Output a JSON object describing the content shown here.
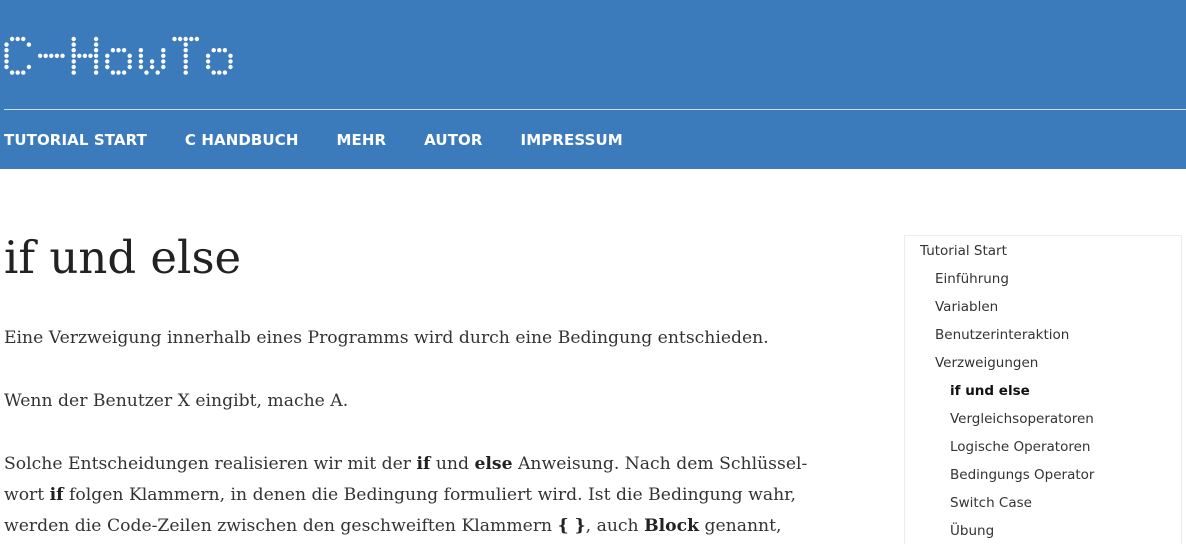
{
  "header": {
    "logo_text": "C-HowTo",
    "brand_color": "#3b7bbb",
    "nav": [
      {
        "label": "TUTORIAL START"
      },
      {
        "label": "C HANDBUCH"
      },
      {
        "label": "MEHR"
      },
      {
        "label": "AUTOR"
      },
      {
        "label": "IMPRESSUM"
      }
    ]
  },
  "main": {
    "title": "if und else",
    "p1": "Eine Verzweigung innerhalb eines Programms wird durch eine Bedingung entschieden.",
    "p2": "Wenn der Benutzer X eingibt, mache A.",
    "p3": {
      "l1a": "Solche Entscheidungen realisieren wir mit der ",
      "l1b": "if",
      "l1c": " und ",
      "l1d": "else",
      "l1e": " Anweisung. Nach dem Schlüssel-",
      "l2a": "wort ",
      "l2b": "if",
      "l2c": " folgen Klammern, in denen die Bedingung formuliert wird. Ist die Bedingung wahr,",
      "l3a": "werden die Code-Zeilen zwischen den geschweiften Klammern ",
      "l3b": "{ }",
      "l3c": ", auch ",
      "l3d": "Block",
      "l3e": " genannt,"
    }
  },
  "sidebar": {
    "items": [
      {
        "label": "Tutorial Start",
        "level": 0
      },
      {
        "label": "Einführung",
        "level": 1
      },
      {
        "label": "Variablen",
        "level": 1
      },
      {
        "label": "Benutzerinteraktion",
        "level": 1
      },
      {
        "label": "Verzweigungen",
        "level": 1
      },
      {
        "label": "if und else",
        "level": 2,
        "active": true
      },
      {
        "label": "Vergleichsoperatoren",
        "level": 2
      },
      {
        "label": "Logische Operatoren",
        "level": 2
      },
      {
        "label": "Bedingungs Operator",
        "level": 2
      },
      {
        "label": "Switch Case",
        "level": 2
      },
      {
        "label": "Übung",
        "level": 2
      }
    ]
  }
}
